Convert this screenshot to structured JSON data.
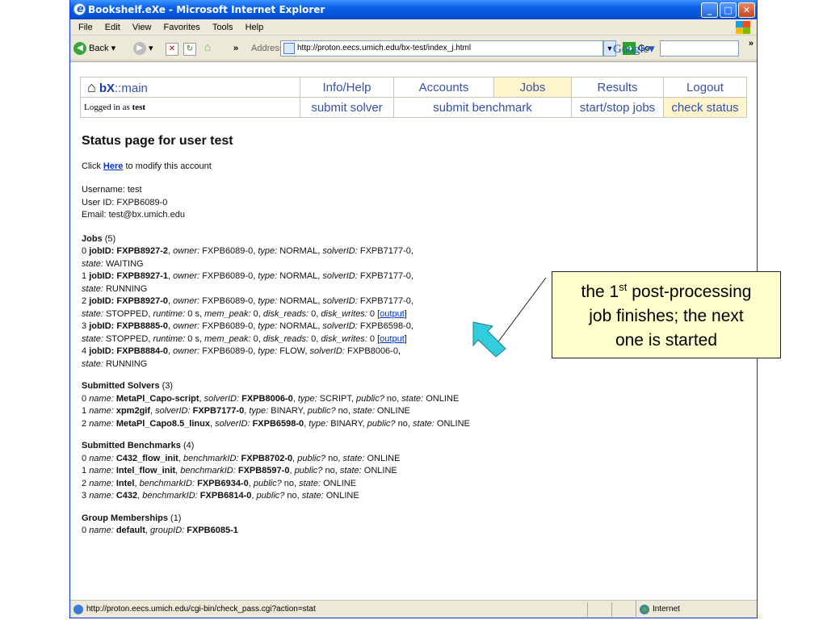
{
  "window": {
    "title": "Bookshelf.eXe - Microsoft Internet Explorer",
    "min_glyph": "_",
    "max_glyph": "□",
    "close_glyph": "✕"
  },
  "menus": [
    "File",
    "Edit",
    "View",
    "Favorites",
    "Tools",
    "Help"
  ],
  "toolbar": {
    "back_label": "Back",
    "address_label": "Address",
    "url": "http://proton.eecs.umich.edu/bx-test/index_j.html",
    "go_label": "Go",
    "google_label": "Google"
  },
  "nav": {
    "brand_prefix": "bX",
    "brand_suffix": "::main",
    "top_tabs": [
      "Info/Help",
      "Accounts",
      "Jobs",
      "Results",
      "Logout"
    ],
    "logged_prefix": "Logged in as",
    "logged_user": "test",
    "sub_tabs": [
      "submit solver",
      "submit benchmark",
      "start/stop jobs",
      "check status"
    ]
  },
  "page": {
    "title": "Status page for user test",
    "click_prefix": "Click",
    "here_link": "Here",
    "click_suffix": "to modify this account",
    "username": "Username: test",
    "userid": "User ID: FXPB6089-0",
    "email": "Email: test@bx.umich.edu"
  },
  "jobs": {
    "heading": "Jobs",
    "count": "(5)",
    "items": [
      {
        "idx": "0",
        "jobid": "FXPB8927-2",
        "owner": "FXPB6089-0",
        "type": "NORMAL",
        "solver": "FXPB7177-0",
        "state": "WAITING",
        "extra": ""
      },
      {
        "idx": "1",
        "jobid": "FXPB8927-1",
        "owner": "FXPB6089-0",
        "type": "NORMAL",
        "solver": "FXPB7177-0",
        "state": "RUNNING",
        "extra": ""
      },
      {
        "idx": "2",
        "jobid": "FXPB8927-0",
        "owner": "FXPB6089-0",
        "type": "NORMAL",
        "solver": "FXPB7177-0",
        "state": "STOPPED",
        "extra": "runtime"
      },
      {
        "idx": "3",
        "jobid": "FXPB8885-0",
        "owner": "FXPB6089-0",
        "type": "NORMAL",
        "solver": "FXPB6598-0",
        "state": "STOPPED",
        "extra": "runtime"
      },
      {
        "idx": "4",
        "jobid": "FXPB8884-0",
        "owner": "FXPB6089-0",
        "type": "FLOW",
        "solver": "FXPB8006-0",
        "state": "RUNNING",
        "extra": ""
      }
    ],
    "runtime_value": "0 s",
    "mem_peak_value": "0",
    "disk_reads_value": "0",
    "disk_writes_value": "0",
    "output_link": "output"
  },
  "solvers": {
    "heading": "Submitted Solvers",
    "count": "(3)",
    "items": [
      {
        "idx": "0",
        "name": "MetaPl_Capo-script",
        "id": "FXPB8006-0",
        "type": "SCRIPT",
        "public": "no",
        "state": "ONLINE"
      },
      {
        "idx": "1",
        "name": "xpm2gif",
        "id": "FXPB7177-0",
        "type": "BINARY",
        "public": "no",
        "state": "ONLINE"
      },
      {
        "idx": "2",
        "name": "MetaPl_Capo8.5_linux",
        "id": "FXPB6598-0",
        "type": "BINARY",
        "public": "no",
        "state": "ONLINE"
      }
    ]
  },
  "benchmarks": {
    "heading": "Submitted Benchmarks",
    "count": "(4)",
    "items": [
      {
        "idx": "0",
        "name": "C432_flow_init",
        "id": "FXPB8702-0",
        "public": "no",
        "state": "ONLINE"
      },
      {
        "idx": "1",
        "name": "Intel_flow_init",
        "id": "FXPB8597-0",
        "public": "no",
        "state": "ONLINE"
      },
      {
        "idx": "2",
        "name": "Intel",
        "id": "FXPB6934-0",
        "public": "no",
        "state": "ONLINE"
      },
      {
        "idx": "3",
        "name": "C432",
        "id": "FXPB6814-0",
        "public": "no",
        "state": "ONLINE"
      }
    ]
  },
  "groups": {
    "heading": "Group Memberships",
    "count": "(1)",
    "items": [
      {
        "idx": "0",
        "name": "default",
        "id": "FXPB6085-1"
      }
    ]
  },
  "statusbar": {
    "url": "http://proton.eecs.umich.edu/cgi-bin/check_pass.cgi?action=stat",
    "zone": "Internet"
  },
  "callout": {
    "line1_prefix": "the 1",
    "line1_sup": "st",
    "line1_suffix": " post-processing",
    "line2": "job finishes; the next",
    "line3": "one is started"
  },
  "colors": {
    "callout_bg": "#ffffcc",
    "arrow_fill": "#33ccdd",
    "active_tab": "#fff5cc",
    "link": "#0033cc"
  }
}
